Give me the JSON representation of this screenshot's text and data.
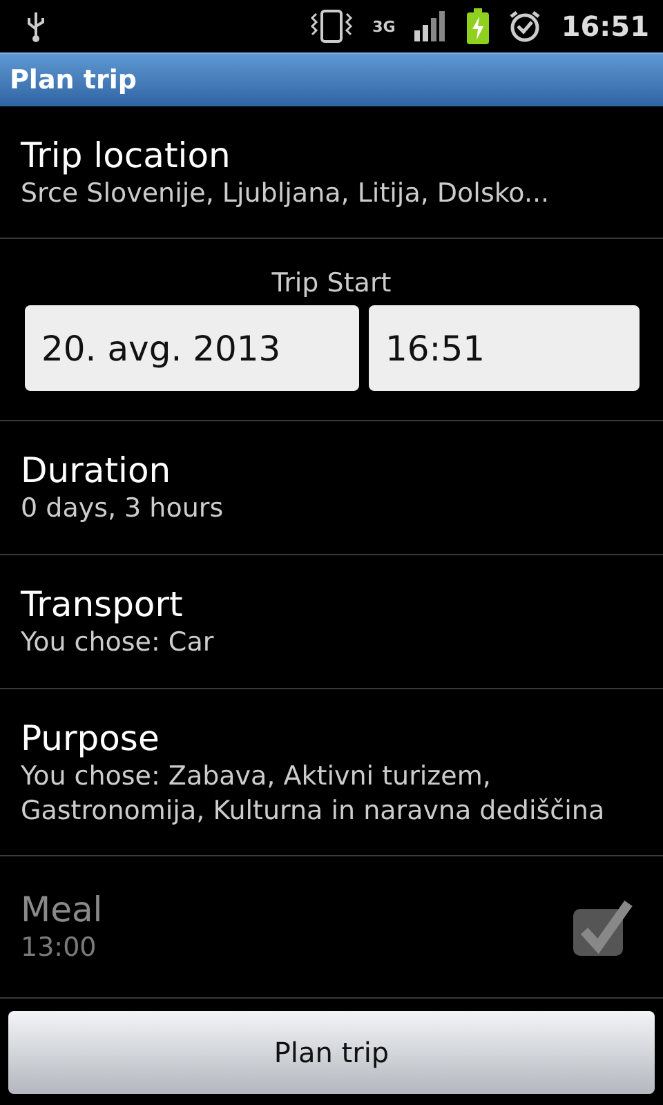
{
  "status_bar": {
    "network": "3G",
    "time": "16:51"
  },
  "title": "Plan trip",
  "items": [
    {
      "kind": "text",
      "title": "Trip location",
      "value": "Srce Slovenije, Ljubljana, Litija, Dolsko..."
    },
    {
      "kind": "datetime",
      "title": "Trip Start",
      "date": "20. avg. 2013",
      "time": "16:51"
    },
    {
      "kind": "text",
      "title": "Duration",
      "value": "0 days, 3 hours"
    },
    {
      "kind": "text",
      "title": "Transport",
      "value": "You chose: Car"
    },
    {
      "kind": "text",
      "title": "Purpose",
      "value": "You chose: Zabava, Aktivni turizem, Gastronomija, Kulturna in naravna dediščina"
    },
    {
      "kind": "checkbox",
      "title": "Meal",
      "value": "13:00",
      "checked": true,
      "disabled": true
    }
  ],
  "button": "Plan trip"
}
